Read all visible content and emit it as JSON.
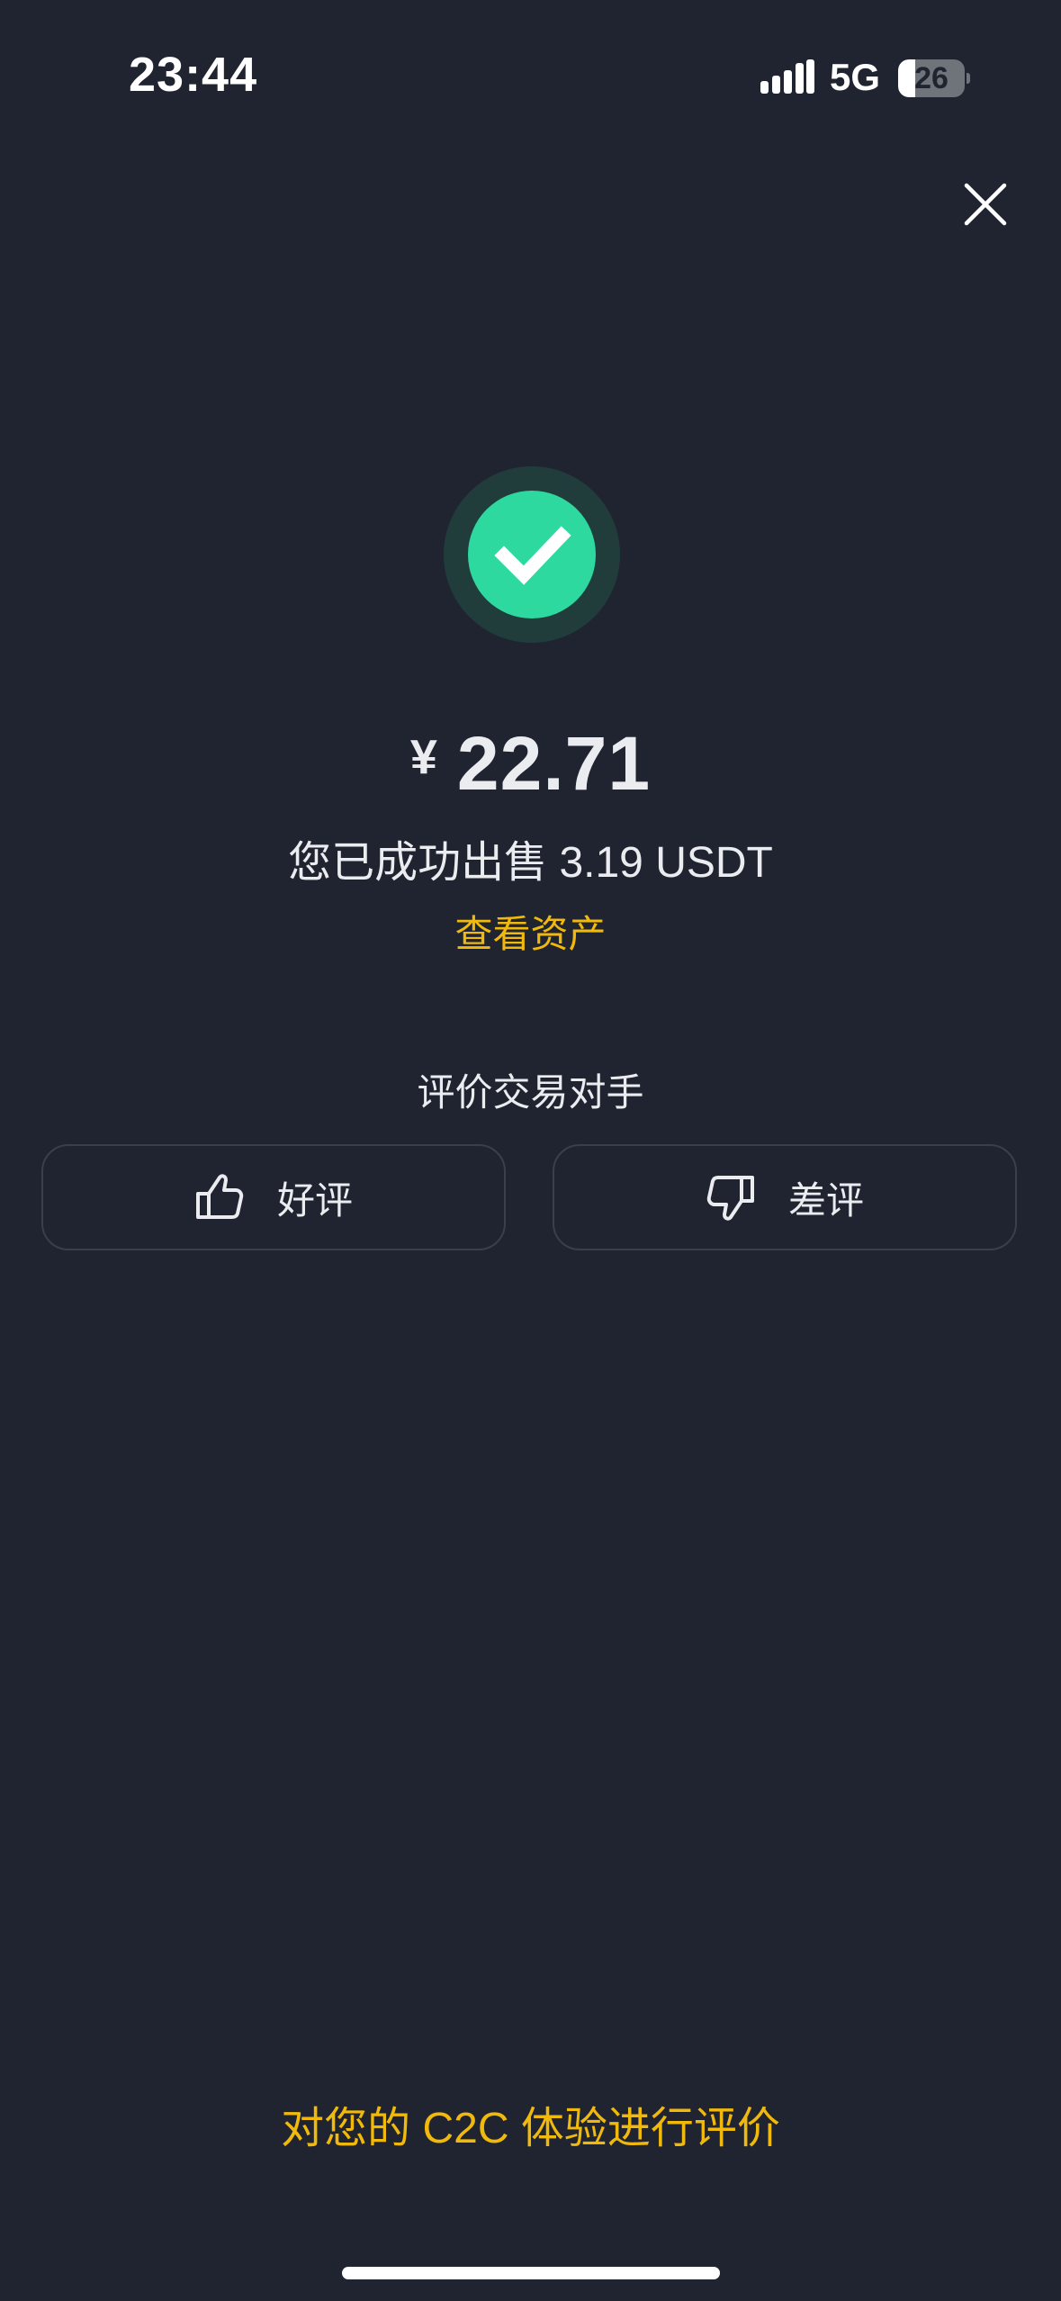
{
  "status_bar": {
    "time": "23:44",
    "network": "5G",
    "battery_level": "26",
    "battery_fraction": 0.26
  },
  "icons": {
    "close": "close-icon",
    "success": "check-icon",
    "thumbs_up": "thumbs-up-icon",
    "thumbs_down": "thumbs-down-icon"
  },
  "result": {
    "currency_symbol": "¥",
    "amount": "22.71",
    "message": "您已成功出售 3.19 USDT",
    "view_assets_label": "查看资产"
  },
  "rating": {
    "title": "评价交易对手",
    "good_label": "好评",
    "bad_label": "差评"
  },
  "footer": {
    "c2c_feedback_label": "对您的 C2C 体验进行评价"
  },
  "colors": {
    "background": "#1f2430",
    "accent_yellow": "#f0b90b",
    "success_green": "#2ed9a0",
    "success_ring": "#213d3b",
    "button_border": "#3a3f4a"
  }
}
